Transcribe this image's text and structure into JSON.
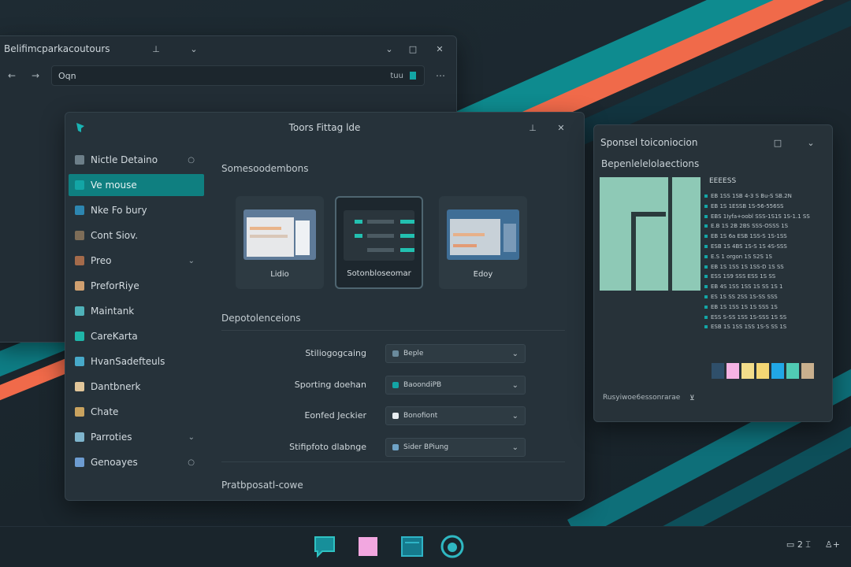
{
  "back_window": {
    "title": "Belifimcparkacoutours",
    "address": "Oqn",
    "address_tag": "tuu"
  },
  "main_window": {
    "title": "Toors Fittag lde",
    "sidebar": [
      {
        "label": "Nictle Detaino",
        "icon_color": "#6d7f89",
        "tail": "○",
        "active": false
      },
      {
        "label": "Ve mouse",
        "icon_color": "#13a5a5",
        "tail": "",
        "active": true
      },
      {
        "label": "Nke Fo bury",
        "icon_color": "#2d86b0",
        "tail": "",
        "active": false
      },
      {
        "label": "Cont Siov.",
        "icon_color": "#7d6d58",
        "tail": "",
        "active": false
      },
      {
        "label": "Preo",
        "icon_color": "#a46b4b",
        "tail": "⌄",
        "active": false
      },
      {
        "label": "PreforRiye",
        "icon_color": "#d0a070",
        "tail": "",
        "active": false
      },
      {
        "label": "Maintank",
        "icon_color": "#4fb2b9",
        "tail": "",
        "active": false
      },
      {
        "label": "CareKarta",
        "icon_color": "#1fb5a8",
        "tail": "",
        "active": false
      },
      {
        "label": "HvanSadefteuls",
        "icon_color": "#47a9c9",
        "tail": "",
        "active": false
      },
      {
        "label": "Dantbnerk",
        "icon_color": "#e1c69a",
        "tail": "",
        "active": false
      },
      {
        "label": "Chate",
        "icon_color": "#c9a35f",
        "tail": "",
        "active": false
      },
      {
        "label": "Parroties",
        "icon_color": "#7fb5cd",
        "tail": "⌄",
        "active": false
      },
      {
        "label": "Genoayes",
        "icon_color": "#6d9cd1",
        "tail": "○",
        "active": false
      }
    ],
    "section_title": "Somesoodembons",
    "themes": [
      {
        "label": "Lidio",
        "selected": false
      },
      {
        "label": "Sotonbloseomar",
        "selected": true
      },
      {
        "label": "Edoy",
        "selected": false
      }
    ],
    "section2_title": "Depotolenceions",
    "settings": [
      {
        "label": "Stiliogogcaing",
        "value": "Beple",
        "icon_color": "#6a8a9c"
      },
      {
        "label": "Sporting doehan",
        "value": "BaoondiPB",
        "icon_color": "#13a5a5"
      },
      {
        "label": "Eonfed Jeckier",
        "value": "Bonofiont",
        "icon_color": "#e8eef1"
      },
      {
        "label": "Stifipfoto dlabnge",
        "value": "Sider BPiung",
        "icon_color": "#6fa3c6"
      }
    ],
    "footer_title": "Pratbposatl-cowe"
  },
  "right_window": {
    "title": "Sponsel toiconiocion",
    "subtitle": "Bepenlelelolaections",
    "info_head": "EEEESS",
    "info_lines": [
      "EB 1SS 1SB 4-3 S Bu-S SB.2N",
      "EB 1S 1ESSB 1S-56-556SS",
      "EBS 1Iyfa+oobl SSS-1S1S 1S-1.1 SS",
      "E.B 1S 2B 2BS SSS-OSSS 1S",
      "EB 1S 6a ESB 1SS-S 1S-1SS",
      "ESB 1S 4BS 1S-S 1S 4S-SSS",
      "E.S 1 orgon 1S S2S 1S",
      "EB 1S 1SS 1S 1SS-D 1S SS",
      "ESS 1S9 SSS ESS 1S SS",
      "EB 4S 1SS 1SS 1S SS 1S 1",
      "ES 1S SS 2SS 1S-SS SSS",
      "EB 1S 1SS 1S 1S SSS 1S",
      "ESS S-SS 1SS 1S-SSS 1S SS",
      "ESB 1S 1SS 1SS 1S-S SS 1S"
    ],
    "swatch_colors": [
      "#2f4f6a",
      "#f5b3e4",
      "#f2dd8a",
      "#f4d774",
      "#21a7e6",
      "#50cbb4",
      "#c9b08e"
    ],
    "footer": "Rusyiwoe6essonrarae"
  },
  "taskbar": {
    "tray_badge": "2",
    "tray_icon": "user-plus"
  },
  "colors": {
    "accent": "#0f7f80",
    "stripe_teal": "#0e8b8f",
    "stripe_orange": "#f06a4a"
  }
}
